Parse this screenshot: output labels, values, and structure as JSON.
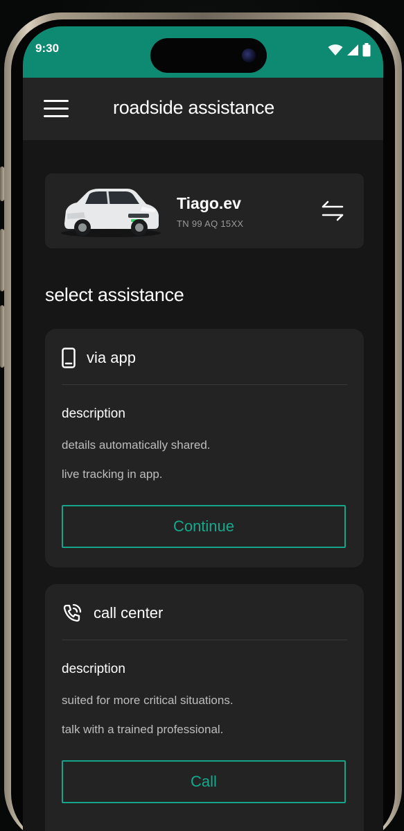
{
  "status_bar": {
    "time": "9:30",
    "icons": [
      "wifi-icon",
      "signal-icon",
      "battery-icon"
    ],
    "color": "#0f8a72"
  },
  "header": {
    "title": "roadside assistance",
    "menu_icon": "hamburger-menu-icon"
  },
  "vehicle": {
    "name": "Tiago.ev",
    "plate": "TN 99 AQ 15XX",
    "switch_icon": "swap-arrows-icon"
  },
  "section": {
    "title": "select assistance"
  },
  "options": [
    {
      "icon": "smartphone-icon",
      "title": "via app",
      "description_label": "description",
      "description_lines": [
        "details automatically shared.",
        "live tracking in app."
      ],
      "button_label": "Continue"
    },
    {
      "icon": "phone-call-icon",
      "title": "call center",
      "description_label": "description",
      "description_lines": [
        "suited for more critical situations.",
        "talk with a trained professional."
      ],
      "button_label": "Call"
    }
  ],
  "theme": {
    "accent": "#14a58a",
    "card_bg": "#232323",
    "screen_bg": "#161616",
    "header_bg": "#242424"
  }
}
